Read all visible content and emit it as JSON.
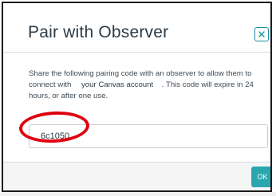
{
  "dialog": {
    "title": "Pair with Observer",
    "close_icon": "close-x-icon",
    "description_before": "Share the following pairing code with an observer to allow them to connect with",
    "canvas_link": "your Canvas account",
    "description_after": ". This code will expire in 24 hours, or after one use.",
    "pairing_code": "6c1050",
    "ok_label": "OK"
  },
  "colors": {
    "accent": "#2aa7ae",
    "annotation": "#e00010",
    "title_text": "#2d3b45"
  }
}
